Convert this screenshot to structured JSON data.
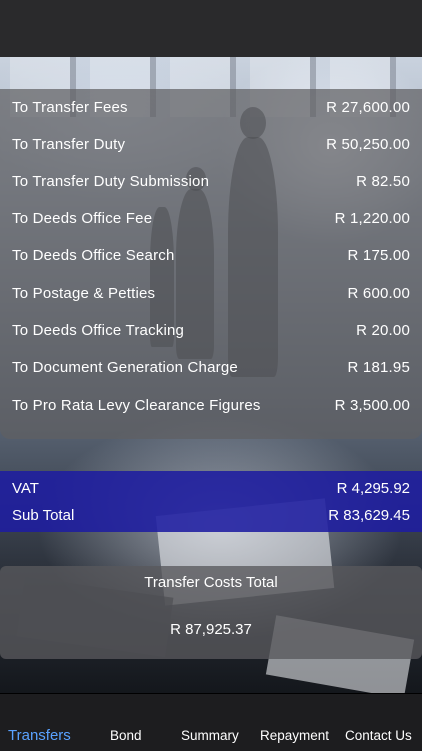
{
  "items": [
    {
      "label": "To Transfer Fees",
      "value": "R 27,600.00"
    },
    {
      "label": "To Transfer Duty",
      "value": "R 50,250.00"
    },
    {
      "label": "To Transfer Duty Submission",
      "value": "R 82.50"
    },
    {
      "label": "To Deeds Office Fee",
      "value": "R 1,220.00"
    },
    {
      "label": "To Deeds Office Search",
      "value": "R 175.00"
    },
    {
      "label": "To Postage & Petties",
      "value": "R 600.00"
    },
    {
      "label": "To Deeds Office Tracking",
      "value": "R 20.00"
    },
    {
      "label": "To Document Generation Charge",
      "value": "R 181.95"
    },
    {
      "label": "To Pro Rata Levy Clearance Figures",
      "value": "R 3,500.00"
    }
  ],
  "summary": {
    "vat_label": "VAT",
    "vat_value": "R 4,295.92",
    "subtotal_label": "Sub Total",
    "subtotal_value": "R 83,629.45"
  },
  "total": {
    "title": "Transfer Costs Total",
    "value": "R 87,925.37"
  },
  "tabs": [
    {
      "label": "Transfers",
      "active": true
    },
    {
      "label": "Bond",
      "active": false
    },
    {
      "label": "Summary",
      "active": false
    },
    {
      "label": "Repayment",
      "active": false
    },
    {
      "label": "Contact Us",
      "active": false
    }
  ],
  "colors": {
    "active_tab": "#5aa2ff",
    "vat_panel": "#1e1ca0",
    "panel": "#5f5f62"
  }
}
